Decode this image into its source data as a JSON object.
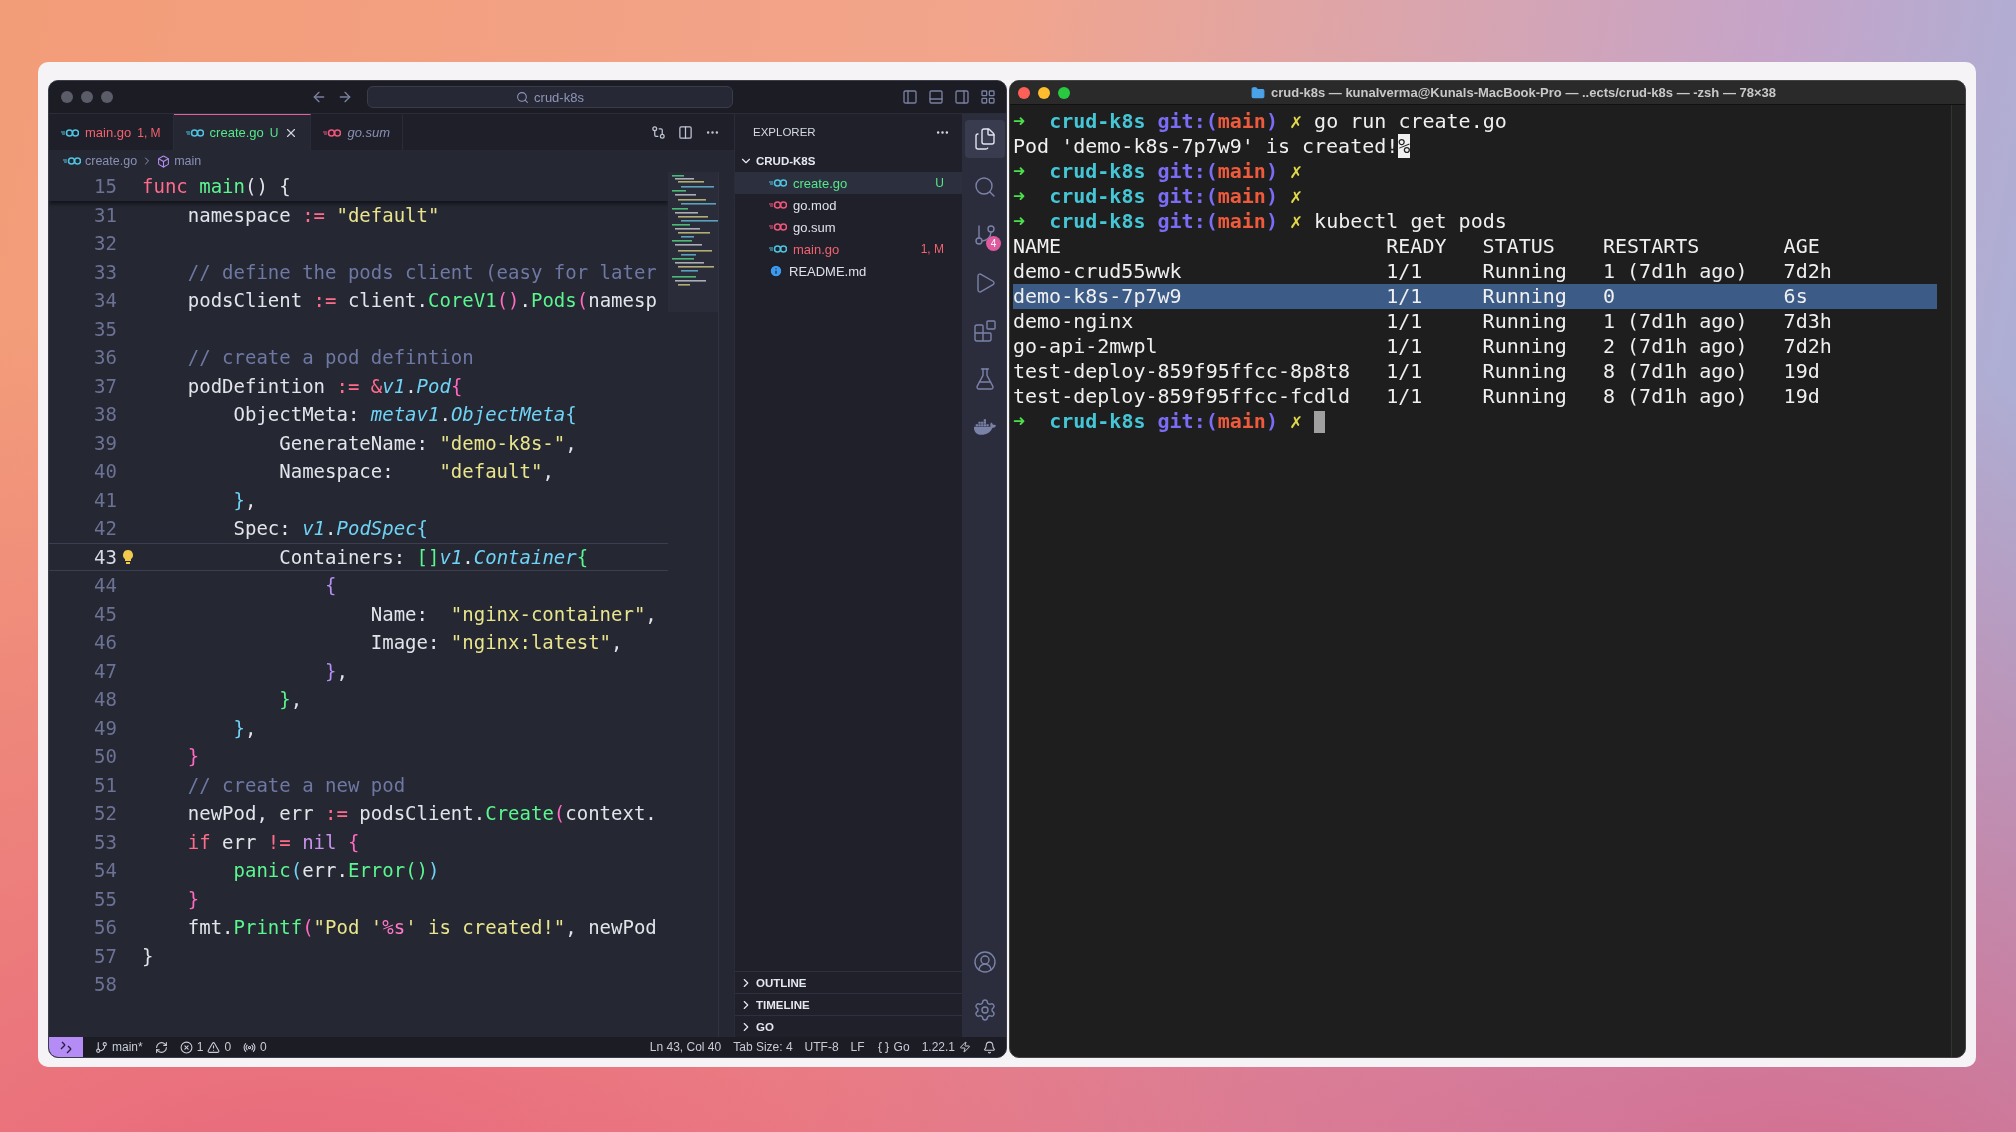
{
  "vscode": {
    "search": "crud-k8s",
    "tabs": [
      {
        "label": "main.go",
        "badge": "1, M",
        "color": "#f2636f",
        "selected": false,
        "preview": false,
        "kind": "go"
      },
      {
        "label": "create.go",
        "badge": "U",
        "color": "#55e88a",
        "selected": true,
        "preview": false,
        "kind": "go"
      },
      {
        "label": "go.sum",
        "color": "#8a90b4",
        "selected": false,
        "preview": true,
        "kind": "mod"
      }
    ],
    "breadcrumb": [
      {
        "label": "create.go",
        "kind": "go"
      },
      {
        "label": "main",
        "kind": "symbol"
      }
    ],
    "editor": {
      "sticky": {
        "num": "15",
        "tokens": [
          {
            "kind": "kw",
            "text": "func"
          },
          {
            "kind": "fn",
            "text": " main"
          },
          {
            "kind": "plain",
            "text": "() {"
          }
        ]
      },
      "lines": [
        {
          "num": "31",
          "current": false,
          "tokens": [
            {
              "kind": "plain",
              "text": "    namespace"
            },
            {
              "kind": "op",
              "text": " := "
            },
            {
              "kind": "str",
              "text": "\"default\""
            }
          ]
        },
        {
          "num": "32",
          "current": false
        },
        {
          "num": "33",
          "current": false,
          "tokens": [
            {
              "kind": "cmt",
              "text": "    // define the pods client (easy for later"
            }
          ]
        },
        {
          "num": "34",
          "current": false,
          "tokens": [
            {
              "kind": "plain",
              "text": "    podsClient"
            },
            {
              "kind": "op",
              "text": " := "
            },
            {
              "kind": "plain",
              "text": "client."
            },
            {
              "kind": "fn",
              "text": "CoreV1"
            },
            {
              "kind": "bracket1",
              "text": "()"
            },
            {
              "kind": "plain",
              "text": "."
            },
            {
              "kind": "fn",
              "text": "Pods"
            },
            {
              "kind": "bracket1",
              "text": "("
            },
            {
              "kind": "plain",
              "text": "namesp"
            }
          ]
        },
        {
          "num": "35",
          "current": false
        },
        {
          "num": "36",
          "current": false,
          "tokens": [
            {
              "kind": "cmt",
              "text": "    // create a pod defintion"
            }
          ]
        },
        {
          "num": "37",
          "current": false,
          "tokens": [
            {
              "kind": "plain",
              "text": "    podDefintion"
            },
            {
              "kind": "op",
              "text": " := &"
            },
            {
              "kind": "type",
              "text": "v1"
            },
            {
              "kind": "plain",
              "text": "."
            },
            {
              "kind": "type",
              "text": "Pod"
            },
            {
              "kind": "bracket1",
              "text": "{"
            }
          ]
        },
        {
          "num": "38",
          "current": false,
          "tokens": [
            {
              "kind": "plain",
              "text": "        ObjectMeta:"
            },
            {
              "kind": "type",
              "text": " metav1"
            },
            {
              "kind": "plain",
              "text": "."
            },
            {
              "kind": "type",
              "text": "ObjectMeta"
            },
            {
              "kind": "bracket2",
              "text": "{"
            }
          ]
        },
        {
          "num": "39",
          "current": false,
          "tokens": [
            {
              "kind": "plain",
              "text": "            GenerateName:"
            },
            {
              "kind": "str",
              "text": " \"demo-k8s-\""
            },
            {
              "kind": "plain",
              "text": ","
            }
          ]
        },
        {
          "num": "40",
          "current": false,
          "tokens": [
            {
              "kind": "plain",
              "text": "            Namespace:"
            },
            {
              "kind": "str",
              "text": "    \"default\""
            },
            {
              "kind": "plain",
              "text": ","
            }
          ]
        },
        {
          "num": "41",
          "current": false,
          "tokens": [
            {
              "kind": "bracket2",
              "text": "        }"
            },
            {
              "kind": "plain",
              "text": ","
            }
          ]
        },
        {
          "num": "42",
          "current": false,
          "tokens": [
            {
              "kind": "plain",
              "text": "        Spec:"
            },
            {
              "kind": "type",
              "text": " v1"
            },
            {
              "kind": "plain",
              "text": "."
            },
            {
              "kind": "type",
              "text": "PodSpec"
            },
            {
              "kind": "bracket2",
              "text": "{"
            }
          ]
        },
        {
          "num": "43",
          "current": true,
          "lightbulb": true,
          "tokens": [
            {
              "kind": "plain",
              "text": "            Containers:"
            },
            {
              "kind": "bracket3",
              "text": " []"
            },
            {
              "kind": "type",
              "text": "v1"
            },
            {
              "kind": "plain",
              "text": "."
            },
            {
              "kind": "type",
              "text": "Container"
            },
            {
              "kind": "bracket3",
              "text": "{"
            }
          ]
        },
        {
          "num": "44",
          "current": false,
          "tokens": [
            {
              "kind": "bracket4",
              "text": "                {"
            }
          ]
        },
        {
          "num": "45",
          "current": false,
          "tokens": [
            {
              "kind": "plain",
              "text": "                    Name:"
            },
            {
              "kind": "str",
              "text": "  \"nginx-container\""
            },
            {
              "kind": "plain",
              "text": ","
            }
          ]
        },
        {
          "num": "46",
          "current": false,
          "tokens": [
            {
              "kind": "plain",
              "text": "                    Image:"
            },
            {
              "kind": "str",
              "text": " \"nginx:latest\""
            },
            {
              "kind": "plain",
              "text": ","
            }
          ]
        },
        {
          "num": "47",
          "current": false,
          "tokens": [
            {
              "kind": "bracket4",
              "text": "                }"
            },
            {
              "kind": "plain",
              "text": ","
            }
          ]
        },
        {
          "num": "48",
          "current": false,
          "tokens": [
            {
              "kind": "bracket3",
              "text": "            }"
            },
            {
              "kind": "plain",
              "text": ","
            }
          ]
        },
        {
          "num": "49",
          "current": false,
          "tokens": [
            {
              "kind": "bracket2",
              "text": "        }"
            },
            {
              "kind": "plain",
              "text": ","
            }
          ]
        },
        {
          "num": "50",
          "current": false,
          "tokens": [
            {
              "kind": "bracket1",
              "text": "    }"
            }
          ]
        },
        {
          "num": "51",
          "current": false,
          "tokens": [
            {
              "kind": "cmt",
              "text": "    // create a new pod"
            }
          ]
        },
        {
          "num": "52",
          "current": false,
          "tokens": [
            {
              "kind": "plain",
              "text": "    newPod, err"
            },
            {
              "kind": "op",
              "text": " := "
            },
            {
              "kind": "plain",
              "text": "podsClient."
            },
            {
              "kind": "fn",
              "text": "Create"
            },
            {
              "kind": "bracket1",
              "text": "("
            },
            {
              "kind": "plain",
              "text": "context."
            }
          ]
        },
        {
          "num": "53",
          "current": false,
          "tokens": [
            {
              "kind": "kw",
              "text": "    if"
            },
            {
              "kind": "plain",
              "text": " err"
            },
            {
              "kind": "op",
              "text": " != "
            },
            {
              "kind": "kw2",
              "text": "nil"
            },
            {
              "kind": "bracket1",
              "text": " {"
            }
          ]
        },
        {
          "num": "54",
          "current": false,
          "tokens": [
            {
              "kind": "fn",
              "text": "        panic"
            },
            {
              "kind": "bracket2",
              "text": "("
            },
            {
              "kind": "plain",
              "text": "err."
            },
            {
              "kind": "fn",
              "text": "Error"
            },
            {
              "kind": "bracket3",
              "text": "()"
            },
            {
              "kind": "bracket2",
              "text": ")"
            }
          ]
        },
        {
          "num": "55",
          "current": false,
          "tokens": [
            {
              "kind": "bracket1",
              "text": "    }"
            }
          ]
        },
        {
          "num": "56",
          "current": false,
          "tokens": [
            {
              "kind": "plain",
              "text": "    fmt."
            },
            {
              "kind": "fn",
              "text": "Printf"
            },
            {
              "kind": "bracket1",
              "text": "("
            },
            {
              "kind": "str",
              "text": "\"Pod '"
            },
            {
              "kind": "verb",
              "text": "%s"
            },
            {
              "kind": "str",
              "text": "' is created!\""
            },
            {
              "kind": "plain",
              "text": ", newPod"
            }
          ]
        },
        {
          "num": "57",
          "current": false,
          "tokens": [
            {
              "kind": "plain",
              "text": "}"
            }
          ]
        },
        {
          "num": "58",
          "current": false
        }
      ]
    },
    "explorer": {
      "title": "EXPLORER",
      "folder": {
        "label": "CRUD-K8S",
        "expanded": true,
        "files": [
          {
            "label": "create.go",
            "badge": "U",
            "color": "#55e88a",
            "kind": "go",
            "selected": true
          },
          {
            "label": "go.mod",
            "color": "#dfe1ea",
            "kind": "mod",
            "selected": false
          },
          {
            "label": "go.sum",
            "color": "#dfe1ea",
            "kind": "mod",
            "selected": false
          },
          {
            "label": "main.go",
            "badge": "1, M",
            "color": "#f2636f",
            "kind": "go",
            "selected": false
          },
          {
            "label": "README.md",
            "color": "#dfe1ea",
            "kind": "info",
            "selected": false
          }
        ]
      },
      "sections": [
        {
          "label": "OUTLINE",
          "expanded": false
        },
        {
          "label": "TIMELINE",
          "expanded": false
        },
        {
          "label": "GO",
          "expanded": false
        }
      ]
    },
    "activity": {
      "top": [
        {
          "kind": "files",
          "selected": true
        },
        {
          "kind": "search",
          "selected": false
        },
        {
          "kind": "scm",
          "selected": false,
          "badge": "4"
        },
        {
          "kind": "run",
          "selected": false
        },
        {
          "kind": "extensions",
          "selected": false
        },
        {
          "kind": "testing",
          "selected": false
        },
        {
          "kind": "docker",
          "selected": false
        }
      ],
      "bottom": [
        {
          "kind": "account",
          "selected": false
        },
        {
          "kind": "settings",
          "selected": false
        }
      ]
    },
    "status_bar": {
      "branch": "main*",
      "errors": "1",
      "warnings": "0",
      "ports": "0",
      "items": [
        "Ln 43, Col 40",
        "Tab Size: 4",
        "UTF-8",
        "LF"
      ],
      "language": "Go",
      "version": "1.22.1"
    }
  },
  "terminal": {
    "title": "crud-k8s — kunalverma@Kunals-MacBook-Pro — ..ects/crud-k8s — -zsh — 78×38",
    "blocks": [
      {
        "kind": "prompt",
        "arrow": "➜",
        "dir": "crud-k8s",
        "git_open": "git:(",
        "branch": "main",
        "git_close": ")",
        "dirty": "✗",
        "command": "go run create.go"
      },
      {
        "kind": "output",
        "text": "Pod 'demo-k8s-7p7w9' is created!",
        "end_mark": "%"
      },
      {
        "kind": "prompt",
        "arrow": "➜",
        "dir": "crud-k8s",
        "git_open": "git:(",
        "branch": "main",
        "git_close": ")",
        "dirty": "✗"
      },
      {
        "kind": "prompt",
        "arrow": "➜",
        "dir": "crud-k8s",
        "git_open": "git:(",
        "branch": "main",
        "git_close": ")",
        "dirty": "✗"
      },
      {
        "kind": "prompt",
        "arrow": "➜",
        "dir": "crud-k8s",
        "git_open": "git:(",
        "branch": "main",
        "git_close": ")",
        "dirty": "✗",
        "command": "kubectl get pods"
      },
      {
        "kind": "table",
        "columns": [
          "NAME",
          "READY",
          "STATUS",
          "RESTARTS",
          "AGE"
        ],
        "rows": [
          {
            "cells": [
              "demo-crud55wwk",
              "1/1",
              "Running",
              "1 (7d1h ago)",
              "7d2h"
            ],
            "selected": false
          },
          {
            "cells": [
              "demo-k8s-7p7w9",
              "1/1",
              "Running",
              "0",
              "6s"
            ],
            "selected": true
          },
          {
            "cells": [
              "demo-nginx",
              "1/1",
              "Running",
              "1 (7d1h ago)",
              "7d3h"
            ],
            "selected": false
          },
          {
            "cells": [
              "go-api-2mwpl",
              "1/1",
              "Running",
              "2 (7d1h ago)",
              "7d2h"
            ],
            "selected": false
          },
          {
            "cells": [
              "test-deploy-859f95ffcc-8p8t8",
              "1/1",
              "Running",
              "8 (7d1h ago)",
              "19d"
            ],
            "selected": false
          },
          {
            "cells": [
              "test-deploy-859f95ffcc-fcdld",
              "1/1",
              "Running",
              "8 (7d1h ago)",
              "19d"
            ],
            "selected": false
          }
        ]
      },
      {
        "kind": "prompt",
        "arrow": "➜",
        "dir": "crud-k8s",
        "git_open": "git:(",
        "branch": "main",
        "git_close": ")",
        "dirty": "✗",
        "cursor": true
      }
    ]
  }
}
